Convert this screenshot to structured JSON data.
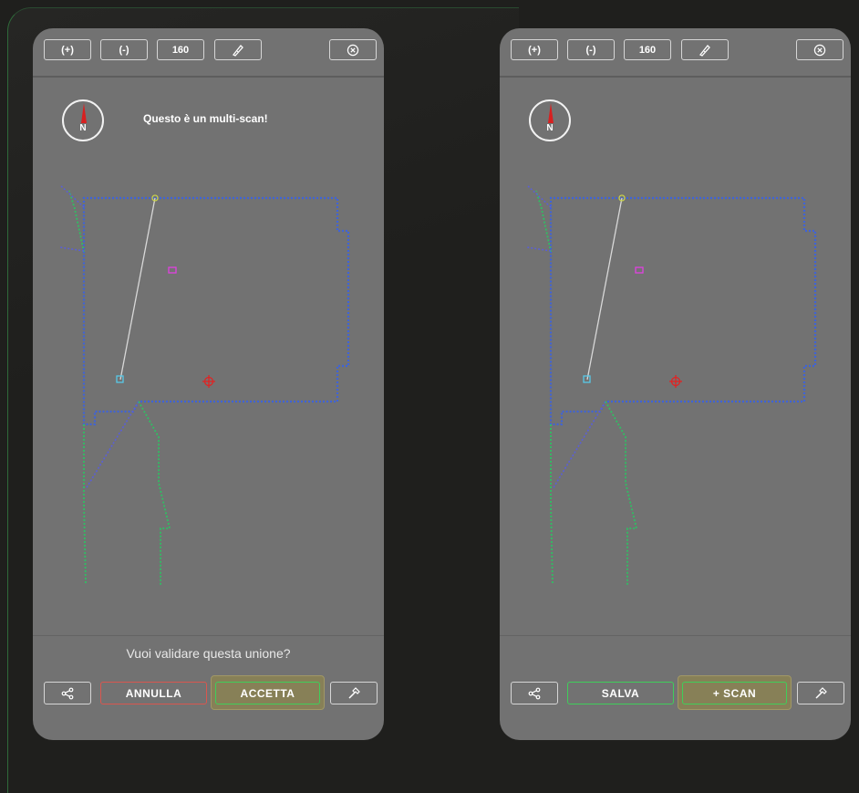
{
  "screens": [
    {
      "toolbar": {
        "zoom_in_label": "(+)",
        "zoom_out_label": "(-)",
        "zoom_value": "160",
        "measure_icon": "ruler-pen-icon",
        "close_icon": "close-circle-icon"
      },
      "compass": {
        "north_label": "N"
      },
      "notice": "Questo è un multi-scan!",
      "question": "Vuoi validare questa unione?",
      "actions": {
        "share_icon": "share-icon",
        "left_button": "ANNULLA",
        "right_button": "ACCETTA",
        "tool_icon": "hammer-icon"
      }
    },
    {
      "toolbar": {
        "zoom_in_label": "(+)",
        "zoom_out_label": "(-)",
        "zoom_value": "160",
        "measure_icon": "ruler-pen-icon",
        "close_icon": "close-circle-icon"
      },
      "compass": {
        "north_label": "N"
      },
      "actions": {
        "share_icon": "share-icon",
        "left_button": "SALVA",
        "right_button": "+ SCAN",
        "tool_icon": "hammer-icon"
      }
    }
  ],
  "colors": {
    "wall_blue": "#3f63d8",
    "path_green": "#2fbf63",
    "marker_magenta": "#e040e0",
    "marker_red": "#e02424",
    "marker_cyan": "#58c8e8",
    "accent_olive": "#878057"
  }
}
